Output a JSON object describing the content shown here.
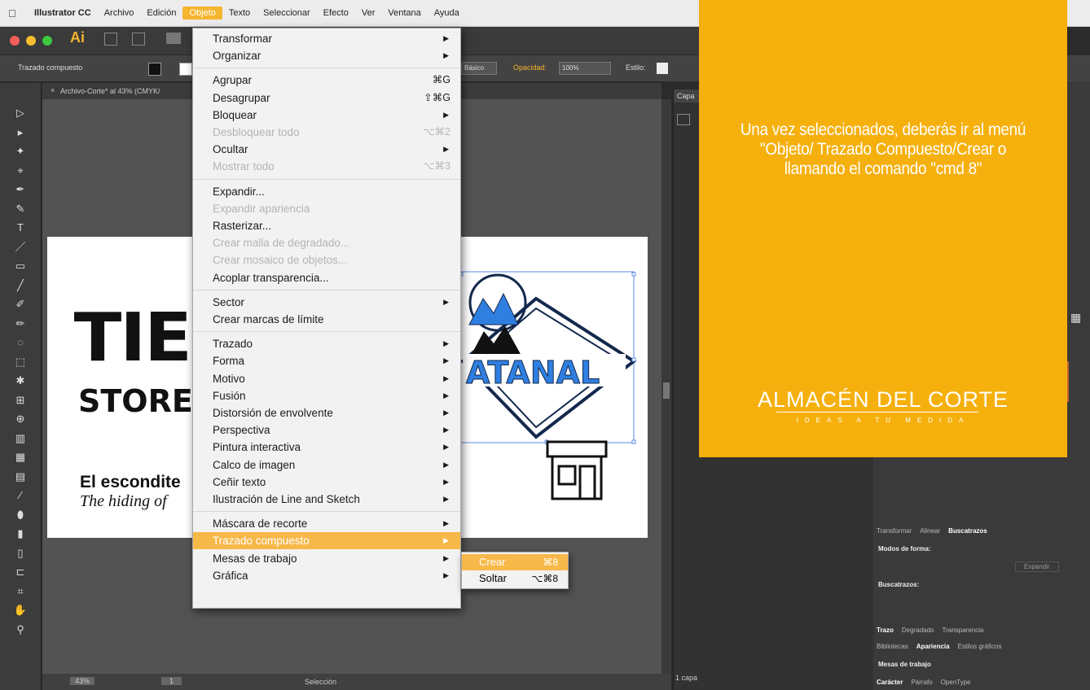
{
  "menubar": {
    "items": [
      "Illustrator CC",
      "Archivo",
      "Edición",
      "Objeto",
      "Texto",
      "Seleccionar",
      "Efecto",
      "Ver",
      "Ventana",
      "Ayuda"
    ],
    "active_index": 3
  },
  "appbar": {
    "logo": "Ai"
  },
  "control_bar": {
    "selection_type": "Trazado compuesto",
    "style_preset": "Básico",
    "opacity_label": "Opacidad:",
    "opacity_value": "100%",
    "style_label": "Estilo:"
  },
  "document_tab": "Archivo-Corte* al 43% (CMYK/",
  "status_bar": {
    "zoom": "43%",
    "artboard": "1",
    "tool": "Selección",
    "layers": "1 capa"
  },
  "layers_panel": {
    "tab": "Capa"
  },
  "object_menu": {
    "items": [
      {
        "label": "Transformar",
        "shortcut": "",
        "submenu": true,
        "disabled": false
      },
      {
        "label": "Organizar",
        "shortcut": "",
        "submenu": true,
        "disabled": false
      },
      {
        "sep": true
      },
      {
        "label": "Agrupar",
        "shortcut": "⌘G",
        "submenu": false,
        "disabled": false
      },
      {
        "label": "Desagrupar",
        "shortcut": "⇧⌘G",
        "submenu": false,
        "disabled": false
      },
      {
        "label": "Bloquear",
        "shortcut": "",
        "submenu": true,
        "disabled": false
      },
      {
        "label": "Desbloquear todo",
        "shortcut": "⌥⌘2",
        "submenu": false,
        "disabled": true
      },
      {
        "label": "Ocultar",
        "shortcut": "",
        "submenu": true,
        "disabled": false
      },
      {
        "label": "Mostrar todo",
        "shortcut": "⌥⌘3",
        "submenu": false,
        "disabled": true
      },
      {
        "sep": true
      },
      {
        "label": "Expandir...",
        "shortcut": "",
        "submenu": false,
        "disabled": false
      },
      {
        "label": "Expandir apariencia",
        "shortcut": "",
        "submenu": false,
        "disabled": true
      },
      {
        "label": "Rasterizar...",
        "shortcut": "",
        "submenu": false,
        "disabled": false
      },
      {
        "label": "Crear malla de degradado...",
        "shortcut": "",
        "submenu": false,
        "disabled": true
      },
      {
        "label": "Crear mosaico de objetos...",
        "shortcut": "",
        "submenu": false,
        "disabled": true
      },
      {
        "label": "Acoplar transparencia...",
        "shortcut": "",
        "submenu": false,
        "disabled": false
      },
      {
        "sep": true
      },
      {
        "label": "Sector",
        "shortcut": "",
        "submenu": true,
        "disabled": false
      },
      {
        "label": "Crear marcas de límite",
        "shortcut": "",
        "submenu": false,
        "disabled": false
      },
      {
        "sep": true
      },
      {
        "label": "Trazado",
        "shortcut": "",
        "submenu": true,
        "disabled": false
      },
      {
        "label": "Forma",
        "shortcut": "",
        "submenu": true,
        "disabled": false
      },
      {
        "label": "Motivo",
        "shortcut": "",
        "submenu": true,
        "disabled": false
      },
      {
        "label": "Fusión",
        "shortcut": "",
        "submenu": true,
        "disabled": false
      },
      {
        "label": "Distorsión de envolvente",
        "shortcut": "",
        "submenu": true,
        "disabled": false
      },
      {
        "label": "Perspectiva",
        "shortcut": "",
        "submenu": true,
        "disabled": false
      },
      {
        "label": "Pintura interactiva",
        "shortcut": "",
        "submenu": true,
        "disabled": false
      },
      {
        "label": "Calco de imagen",
        "shortcut": "",
        "submenu": true,
        "disabled": false
      },
      {
        "label": "Ceñir texto",
        "shortcut": "",
        "submenu": true,
        "disabled": false
      },
      {
        "label": "Ilustración de Line and Sketch",
        "shortcut": "",
        "submenu": true,
        "disabled": false
      },
      {
        "sep": true
      },
      {
        "label": "Máscara de recorte",
        "shortcut": "",
        "submenu": true,
        "disabled": false
      },
      {
        "label": "Trazado compuesto",
        "shortcut": "",
        "submenu": true,
        "disabled": false,
        "highlighted": true
      },
      {
        "label": "Mesas de trabajo",
        "shortcut": "",
        "submenu": true,
        "disabled": false
      },
      {
        "label": "Gráfica",
        "shortcut": "",
        "submenu": true,
        "disabled": false
      }
    ]
  },
  "compound_submenu": {
    "items": [
      {
        "label": "Crear",
        "shortcut": "⌘8",
        "highlighted": true
      },
      {
        "label": "Soltar",
        "shortcut": "⌥⌘8",
        "highlighted": false
      }
    ]
  },
  "artboard": {
    "title_big": "TIE",
    "store": "STORE",
    "tagline_bold": "El escondite",
    "tagline_italic": "The hiding of",
    "logo_word": "ATANAL"
  },
  "right_panel": {
    "tabs1": [
      "Transformar",
      "Alinear",
      "Buscatrazos"
    ],
    "shape_modes": "Modos de forma:",
    "expand": "Expandir",
    "pathfinders": "Buscatrazos:",
    "tabs2": [
      "Trazo",
      "Degradado",
      "Transparencia"
    ],
    "tabs3": [
      "Bibliotecas",
      "Apariencia",
      "Estilos gráficos"
    ],
    "artboards": "Mesas de trabajo",
    "tabs4": [
      "Carácter",
      "Párrafo",
      "OpenType"
    ]
  },
  "overlay": {
    "instruction": "Una vez seleccionados,  deberás ir al menú \"Objeto/ Trazado Compuesto/Crear o llamando el comando \"cmd 8\"",
    "brand": "ALMACÉN DEL CORTE",
    "tagline": "IDEAS A TU MEDIDA",
    "color": "#f6b00d"
  },
  "colors": {
    "accent": "#f7b84a",
    "brand_yellow": "#f6b00d",
    "ai_orange": "#f5b52e",
    "logo_blue": "#2f7fe0"
  }
}
